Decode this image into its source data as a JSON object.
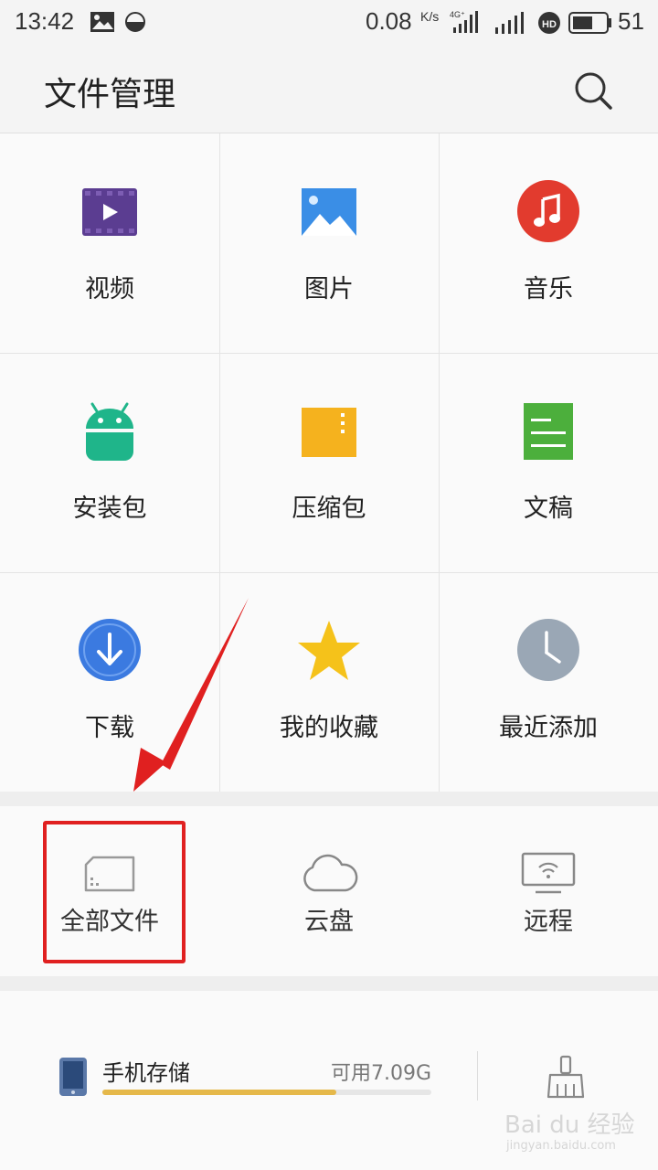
{
  "status_bar": {
    "time": "13:42",
    "net_speed": "0.08",
    "net_unit": "K/s",
    "network_type": "4G+",
    "battery": "51"
  },
  "header": {
    "title": "文件管理",
    "search_icon": "search-icon"
  },
  "categories": [
    {
      "label": "视频",
      "icon": "video-icon",
      "color": "#5b3d91"
    },
    {
      "label": "图片",
      "icon": "image-icon",
      "color": "#3a8ee6"
    },
    {
      "label": "音乐",
      "icon": "music-icon",
      "color": "#e23b2e"
    },
    {
      "label": "安装包",
      "icon": "android-icon",
      "color": "#1fb58a"
    },
    {
      "label": "压缩包",
      "icon": "archive-icon",
      "color": "#f5b21e"
    },
    {
      "label": "文稿",
      "icon": "document-icon",
      "color": "#4caf3c"
    },
    {
      "label": "下载",
      "icon": "download-icon",
      "color": "#3b7ae0"
    },
    {
      "label": "我的收藏",
      "icon": "star-icon",
      "color": "#f5c21a"
    },
    {
      "label": "最近添加",
      "icon": "clock-icon",
      "color": "#9aa7b5"
    }
  ],
  "locations": [
    {
      "label": "全部文件",
      "icon": "sd-card-icon"
    },
    {
      "label": "云盘",
      "icon": "cloud-icon"
    },
    {
      "label": "远程",
      "icon": "remote-monitor-icon"
    }
  ],
  "storage": {
    "label": "手机存储",
    "available": "可用7.09G",
    "used_fraction": 0.71,
    "icon": "phone-icon",
    "clean_icon": "broom-icon"
  },
  "watermark": {
    "text": "Bai du 经验",
    "sub": "jingyan.baidu.com"
  },
  "annotation": {
    "arrow_color": "#e02020",
    "box_color": "#e02020"
  }
}
